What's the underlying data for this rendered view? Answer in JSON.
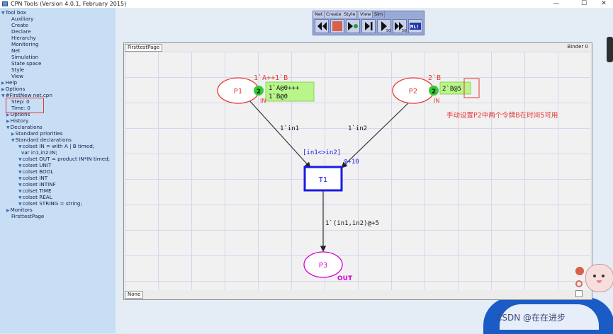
{
  "window": {
    "title": "CPN Tools (Version 4.0.1, February 2015)",
    "minimize": "—",
    "maximize": "☐",
    "close": "✕"
  },
  "sidebar": {
    "items": [
      {
        "text": "Tool box",
        "tri": "▼"
      },
      {
        "text": "Auxiliary"
      },
      {
        "text": "Create"
      },
      {
        "text": "Declare"
      },
      {
        "text": "Hierarchy"
      },
      {
        "text": "Monitoring"
      },
      {
        "text": "Net"
      },
      {
        "text": "Simulation"
      },
      {
        "text": "State space"
      },
      {
        "text": "Style"
      },
      {
        "text": "View"
      },
      {
        "text": "Help",
        "tri": "▶"
      },
      {
        "text": "Options",
        "tri": "▶"
      },
      {
        "text": "#FirstNew net.cpn",
        "tri": "▼"
      },
      {
        "text": "Step: 0"
      },
      {
        "text": "Time: 0"
      },
      {
        "text": "Options",
        "tri": "▶"
      },
      {
        "text": "History",
        "tri": "▶"
      },
      {
        "text": "Declarations",
        "tri": "▼"
      },
      {
        "text": "Standard priorities",
        "tri": "▶"
      },
      {
        "text": "Standard declarations",
        "tri": "▼"
      },
      {
        "text": "colset IN = with A | B timed;",
        "tri": "▼"
      },
      {
        "text": "var in1,in2:IN;"
      },
      {
        "text": "colset OUT = product IN*IN timed;",
        "tri": "▼"
      },
      {
        "text": "colset UNIT",
        "tri": "▼"
      },
      {
        "text": "colset BOOL",
        "tri": "▼"
      },
      {
        "text": "colset INT",
        "tri": "▼"
      },
      {
        "text": "colset INTINF",
        "tri": "▼"
      },
      {
        "text": "colset TIME",
        "tri": "▼"
      },
      {
        "text": "colset REAL",
        "tri": "▼"
      },
      {
        "text": "colset STRING = string;",
        "tri": "▼"
      },
      {
        "text": "Monitors",
        "tri": "▶"
      },
      {
        "text": "FirsttestPage"
      }
    ]
  },
  "palette": {
    "tabs": [
      "Net",
      "Create",
      "Style",
      "View",
      "Sim"
    ],
    "active": "Sim"
  },
  "binder": {
    "tab": "FirsttestPage",
    "label": "Binder 0",
    "footer": "None"
  },
  "net": {
    "p1": {
      "name": "P1",
      "marking": "1`A++1`B",
      "count": "2",
      "tokens": [
        "1`A@0+++",
        "1`B@0"
      ]
    },
    "p2": {
      "name": "P2",
      "marking": "2`B",
      "count": "2",
      "tokens": [
        "2`B@5"
      ]
    },
    "p3": {
      "name": "P3",
      "port": "OUT"
    },
    "t1": {
      "name": "T1",
      "guard": "[in1<>in2]",
      "delay": "@+10"
    },
    "arc1": "1`in1",
    "arc2": "1`in2",
    "arc3": "1`(in1,in2)@+5",
    "annotation": "手动设置P2中两个令牌B在时间5可用",
    "in_tag": "IN",
    "in_tag2": "IN"
  },
  "watermark": "CSDN @在在进步",
  "colors": {
    "place_stroke": "#e53935",
    "transition_stroke": "#1a1ae6",
    "token_bg": "#b8f58a",
    "count_bg": "#33cc33",
    "guard": "#1a1ae6",
    "out_port": "#d600d6",
    "annotation": "#e53935"
  }
}
